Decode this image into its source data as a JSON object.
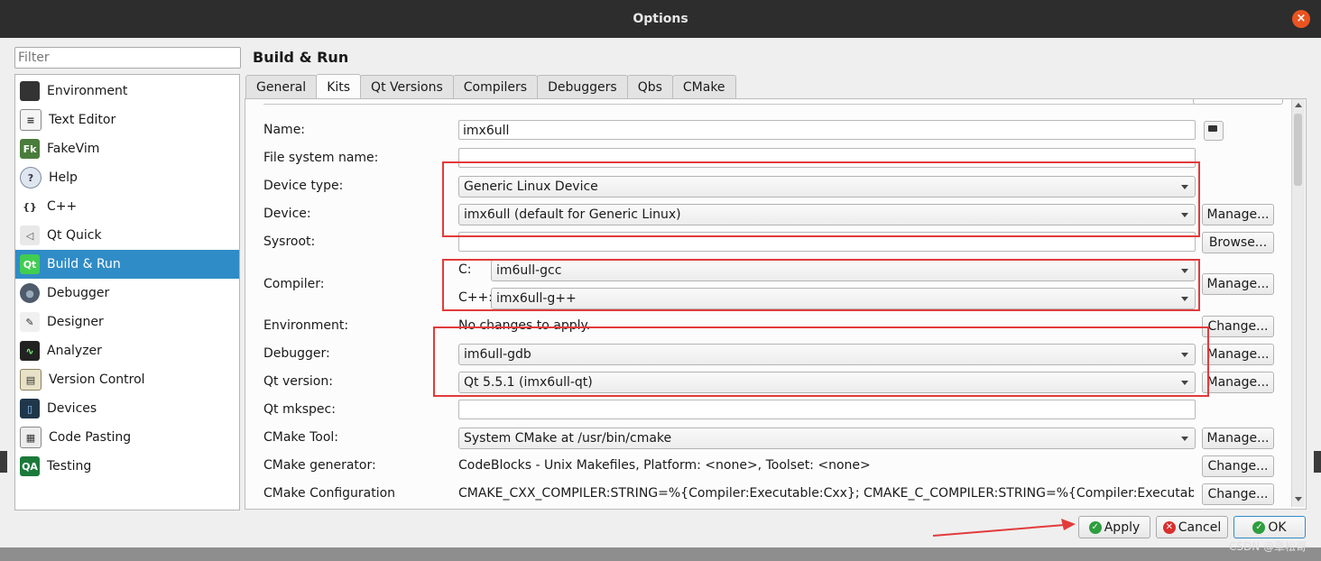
{
  "window": {
    "title": "Options",
    "close_label": "×"
  },
  "filter": {
    "placeholder": "Filter"
  },
  "sidebar": {
    "items": [
      {
        "label": "Environment",
        "icon": "monitor-icon",
        "glyph": ""
      },
      {
        "label": "Text Editor",
        "icon": "text-editor-icon",
        "glyph": "≡"
      },
      {
        "label": "FakeVim",
        "icon": "fakevim-icon",
        "glyph": "Fk"
      },
      {
        "label": "Help",
        "icon": "help-icon",
        "glyph": "?"
      },
      {
        "label": "C++",
        "icon": "cpp-icon",
        "glyph": "{}"
      },
      {
        "label": "Qt Quick",
        "icon": "qt-quick-icon",
        "glyph": "◁"
      },
      {
        "label": "Build & Run",
        "icon": "build-run-icon",
        "glyph": "Qt"
      },
      {
        "label": "Debugger",
        "icon": "debugger-icon",
        "glyph": "●"
      },
      {
        "label": "Designer",
        "icon": "designer-icon",
        "glyph": "✎"
      },
      {
        "label": "Analyzer",
        "icon": "analyzer-icon",
        "glyph": "∿"
      },
      {
        "label": "Version Control",
        "icon": "version-control-icon",
        "glyph": "▤"
      },
      {
        "label": "Devices",
        "icon": "devices-icon",
        "glyph": "▯"
      },
      {
        "label": "Code Pasting",
        "icon": "code-pasting-icon",
        "glyph": "▦"
      },
      {
        "label": "Testing",
        "icon": "testing-icon",
        "glyph": "QA"
      }
    ],
    "active_index": 6
  },
  "main": {
    "title": "Build & Run",
    "tabs": [
      "General",
      "Kits",
      "Qt Versions",
      "Compilers",
      "Debuggers",
      "Qbs",
      "CMake"
    ],
    "active_tab": 1
  },
  "kit": {
    "name_label": "Name:",
    "name_value": "imx6ull",
    "fs_label": "File system name:",
    "fs_value": "",
    "device_type_label": "Device type:",
    "device_type_value": "Generic Linux Device",
    "device_label": "Device:",
    "device_value": "imx6ull (default for Generic Linux)",
    "sysroot_label": "Sysroot:",
    "sysroot_value": "",
    "compiler_label": "Compiler:",
    "c_label": "C:",
    "c_value": "im6ull-gcc",
    "cpp_label": "C++:",
    "cpp_value": "imx6ull-g++",
    "environment_label": "Environment:",
    "environment_value": "No changes to apply.",
    "debugger_label": "Debugger:",
    "debugger_value": "im6ull-gdb",
    "qt_version_label": "Qt version:",
    "qt_version_value": "Qt 5.5.1 (imx6ull-qt)",
    "qt_mkspec_label": "Qt mkspec:",
    "qt_mkspec_value": "",
    "cmake_tool_label": "CMake Tool:",
    "cmake_tool_value": "System CMake at /usr/bin/cmake",
    "cmake_generator_label": "CMake generator:",
    "cmake_generator_value": "CodeBlocks - Unix Makefiles, Platform: <none>, Toolset: <none>",
    "cmake_config_label": "CMake Configuration",
    "cmake_config_value": "CMAKE_CXX_COMPILER:STRING=%{Compiler:Executable:Cxx}; CMAKE_C_COMPILER:STRING=%{Compiler:Executable:..."
  },
  "buttons": {
    "manage": "Manage...",
    "browse": "Browse...",
    "change": "Change...",
    "apply": "Apply",
    "cancel": "Cancel",
    "ok": "OK"
  },
  "colors": {
    "accent": "#308cc6",
    "annotation": "#e23b3b",
    "titlebar": "#2d2d2d"
  },
  "watermark": "CSDN @章松哥"
}
